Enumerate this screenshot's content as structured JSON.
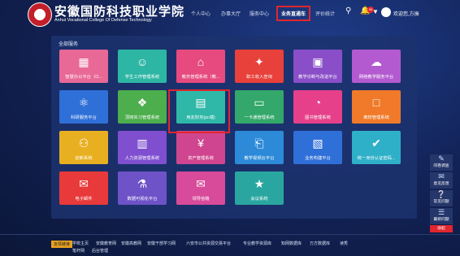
{
  "header": {
    "logo_cn": "安徽国防科技职业学院",
    "logo_en": "Anhui Vocational College Of Defense Technology",
    "nav": [
      "个人中心",
      "办事大厅",
      "服务中心",
      "业务直通车",
      "评价统计"
    ],
    "active_nav_index": 3,
    "notification_count": "99",
    "user_greeting": "欢迎您,方振"
  },
  "panel": {
    "title": "全部服务",
    "tiles": [
      {
        "label": "智慧办公平台（O...",
        "icon": "grid-icon",
        "color": "#e86896"
      },
      {
        "label": "学生工作管理系统",
        "icon": "student-icon",
        "color": "#2eb6a4"
      },
      {
        "label": "教务管理系统（教...",
        "icon": "graduation-cap-icon",
        "color": "#e64a7f"
      },
      {
        "label": "职工收入查询",
        "icon": "molecule-icon",
        "color": "#e8403a"
      },
      {
        "label": "教学诊断与改进平台",
        "icon": "qrcode-icon",
        "color": "#8a4fc8"
      },
      {
        "label": "网络教学服务平台",
        "icon": "cloud-icon",
        "color": "#b35ad0"
      },
      {
        "label": "科研服务平台",
        "icon": "atom-icon",
        "color": "#2f6fd8"
      },
      {
        "label": "顶岗实习管理系统",
        "icon": "certificate-icon",
        "color": "#4cae4c"
      },
      {
        "label": "用友财务(pc端)",
        "icon": "finance-card-icon",
        "color": "#2fb8a8"
      },
      {
        "label": "一卡通管理系统",
        "icon": "card-icon",
        "color": "#33a86a"
      },
      {
        "label": "图书管理系统",
        "icon": "pie-chart-icon",
        "color": "#e6408a"
      },
      {
        "label": "离校管理系统",
        "icon": "box-icon",
        "color": "#f07a2a"
      },
      {
        "label": "迎新系统",
        "icon": "people-icon",
        "color": "#e8b020"
      },
      {
        "label": "人力资源管理系统",
        "icon": "hr-icon",
        "color": "#7f4fd0"
      },
      {
        "label": "资产管理系统",
        "icon": "yen-icon",
        "color": "#d0458f"
      },
      {
        "label": "教学视频云平台",
        "icon": "inbox-icon",
        "color": "#2c8ad8"
      },
      {
        "label": "业务构建平台",
        "icon": "building-icon",
        "color": "#2f6fd8"
      },
      {
        "label": "统一身份认证密码...",
        "icon": "shield-check-icon",
        "color": "#2eb0c8"
      },
      {
        "label": "电子邮件",
        "icon": "mail-icon",
        "color": "#e83a3a"
      },
      {
        "label": "数据可视化平台",
        "icon": "flask-icon",
        "color": "#6d52c8"
      },
      {
        "label": "领导信箱",
        "icon": "leader-mail-icon",
        "color": "#d84a9a"
      },
      {
        "label": "会议系统",
        "icon": "award-icon",
        "color": "#2aa6a0"
      }
    ]
  },
  "float_menu": [
    {
      "label": "问卷调查",
      "icon": "pencil-icon"
    },
    {
      "label": "意见反馈",
      "icon": "chat-icon"
    },
    {
      "label": "常见问题",
      "icon": "question-icon"
    },
    {
      "label": "最新问题",
      "icon": "list-icon"
    },
    {
      "label": "收起",
      "icon": ""
    }
  ],
  "footer": {
    "tag": "友情链接",
    "links": [
      "学校主页",
      "安徽教育网",
      "安徽高教网",
      "安徽干部学习网",
      "六安市公共资源交易平台",
      "专业教学资源库",
      "知网数据库",
      "万方数据库",
      "读秀",
      "笔杆网",
      "后台管理"
    ]
  },
  "colors": {
    "accent": "#e0262e",
    "background": "#13245a",
    "panel": "#1c326e"
  }
}
